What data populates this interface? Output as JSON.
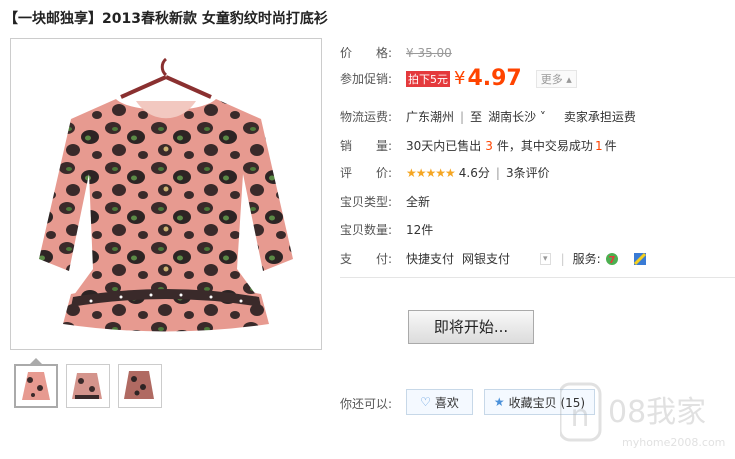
{
  "product": {
    "title": "【一块邮独享】2013春秋新款 女童豹纹时尚打底衫"
  },
  "price": {
    "label": "价　　格:",
    "original": "¥ 35.00",
    "promo_label": "参加促销:",
    "promo_tag": "拍下5元",
    "currency": "¥",
    "amount": "4.97",
    "more": "更多 ▴"
  },
  "shipping": {
    "label": "物流运费:",
    "from": "广东潮州",
    "to_word": "至",
    "to": "湖南长沙 ˅",
    "fee": "卖家承担运费"
  },
  "sales": {
    "label": "销　　量:",
    "prefix": "30天内已售出",
    "count": "3",
    "mid": "件，其中交易成功",
    "success": "1",
    "suffix": "件"
  },
  "rating": {
    "label": "评　　价:",
    "stars": "★★★★★",
    "score": "4.6分",
    "reviews": "3条评价"
  },
  "condition": {
    "label": "宝贝类型:",
    "value": "全新"
  },
  "quantity": {
    "label": "宝贝数量:",
    "value": "12件"
  },
  "payment": {
    "label": "支　　付:",
    "method1": "快捷支付",
    "method2": "网银支付",
    "service_label": "服务:"
  },
  "actions": {
    "buy": "即将开始...",
    "also_label": "你还可以:",
    "like": "喜欢",
    "fav": "收藏宝贝 (15)"
  },
  "watermark": {
    "text": "08我家",
    "url": "myhome2008.com"
  },
  "colors": {
    "accent": "#ff4400",
    "promo": "#e4393c"
  }
}
